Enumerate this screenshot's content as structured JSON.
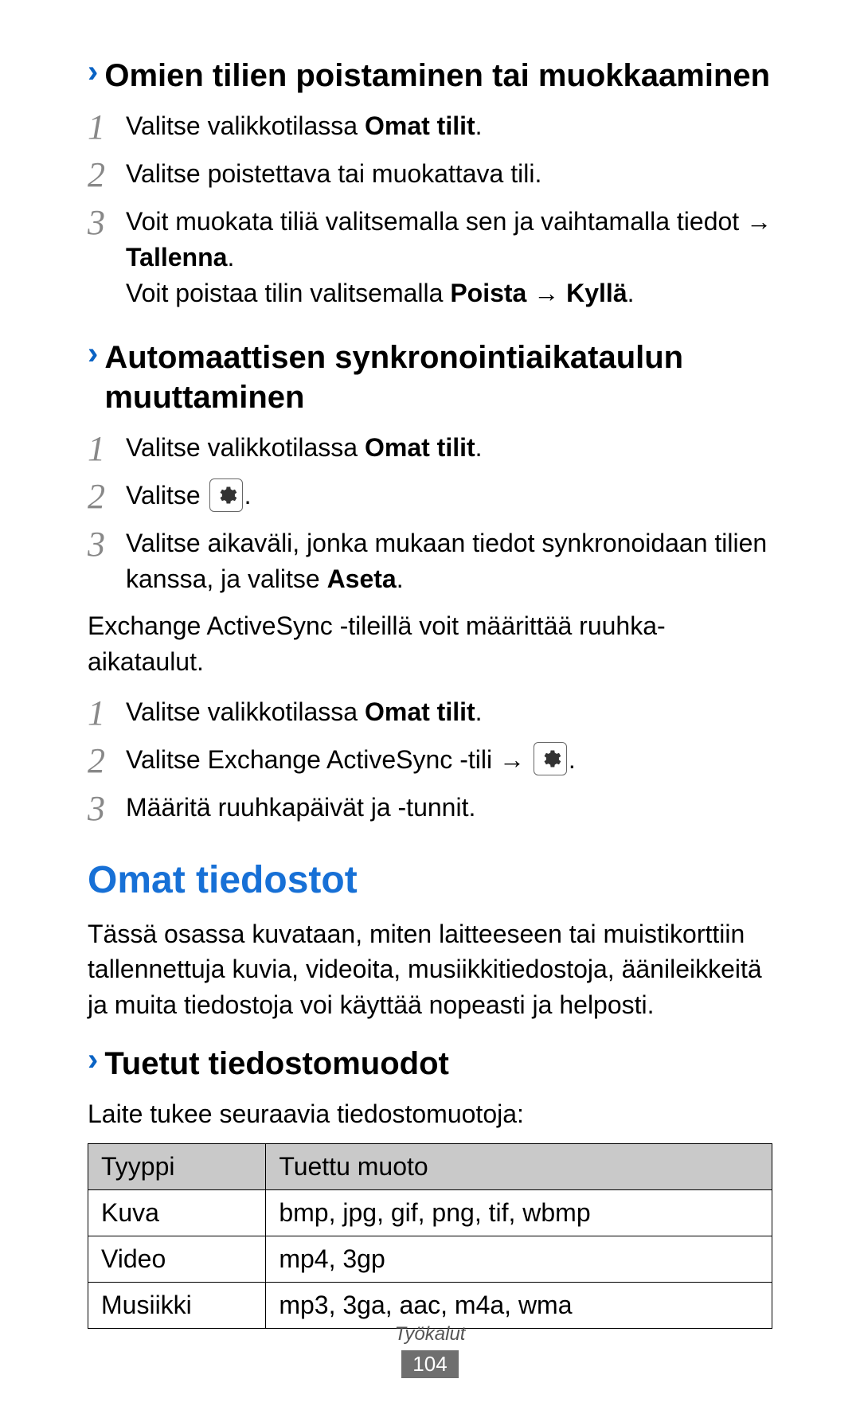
{
  "section1": {
    "title": "Omien tilien poistaminen tai muokkaaminen",
    "steps": [
      {
        "num": "1",
        "prefix": "Valitse valikkotilassa ",
        "bold1": "Omat tilit",
        "suffix": "."
      },
      {
        "num": "2",
        "text": "Valitse poistettava tai muokattava tili."
      },
      {
        "num": "3",
        "line1_prefix": "Voit muokata tiliä valitsemalla sen ja vaihtamalla tiedot → ",
        "line1_bold": "Tallenna",
        "line1_suffix": ".",
        "line2_prefix": "Voit poistaa tilin valitsemalla ",
        "line2_bold1": "Poista",
        "line2_mid": " → ",
        "line2_bold2": "Kyllä",
        "line2_suffix": "."
      }
    ]
  },
  "section2": {
    "title": "Automaattisen synkronointiaikataulun muuttaminen",
    "steps": [
      {
        "num": "1",
        "prefix": "Valitse valikkotilassa ",
        "bold1": "Omat tilit",
        "suffix": "."
      },
      {
        "num": "2",
        "prefix": "Valitse ",
        "has_icon": true,
        "suffix": "."
      },
      {
        "num": "3",
        "prefix": "Valitse aikaväli, jonka mukaan tiedot synkronoidaan tilien kanssa, ja valitse ",
        "bold1": "Aseta",
        "suffix": "."
      }
    ],
    "note": "Exchange ActiveSync -tileillä voit määrittää ruuhka-aikataulut.",
    "steps2": [
      {
        "num": "1",
        "prefix": "Valitse valikkotilassa ",
        "bold1": "Omat tilit",
        "suffix": "."
      },
      {
        "num": "2",
        "prefix": "Valitse Exchange ActiveSync -tili → ",
        "has_icon": true,
        "suffix": "."
      },
      {
        "num": "3",
        "text": "Määritä ruuhkapäivät ja -tunnit."
      }
    ]
  },
  "section3": {
    "heading": "Omat tiedostot",
    "intro": "Tässä osassa kuvataan, miten laitteeseen tai muistikorttiin tallennettuja kuvia, videoita, musiikkitiedostoja, äänileikkeitä ja muita tiedostoja voi käyttää nopeasti ja helposti.",
    "sub_title": "Tuetut tiedostomuodot",
    "sub_intro": "Laite tukee seuraavia tiedostomuotoja:",
    "table": {
      "head": [
        "Tyyppi",
        "Tuettu muoto"
      ],
      "rows": [
        [
          "Kuva",
          "bmp, jpg, gif, png, tif, wbmp"
        ],
        [
          "Video",
          "mp4, 3gp"
        ],
        [
          "Musiikki",
          "mp3, 3ga, aac, m4a, wma"
        ]
      ]
    }
  },
  "footer": {
    "category": "Työkalut",
    "page": "104"
  },
  "chevron": "›"
}
